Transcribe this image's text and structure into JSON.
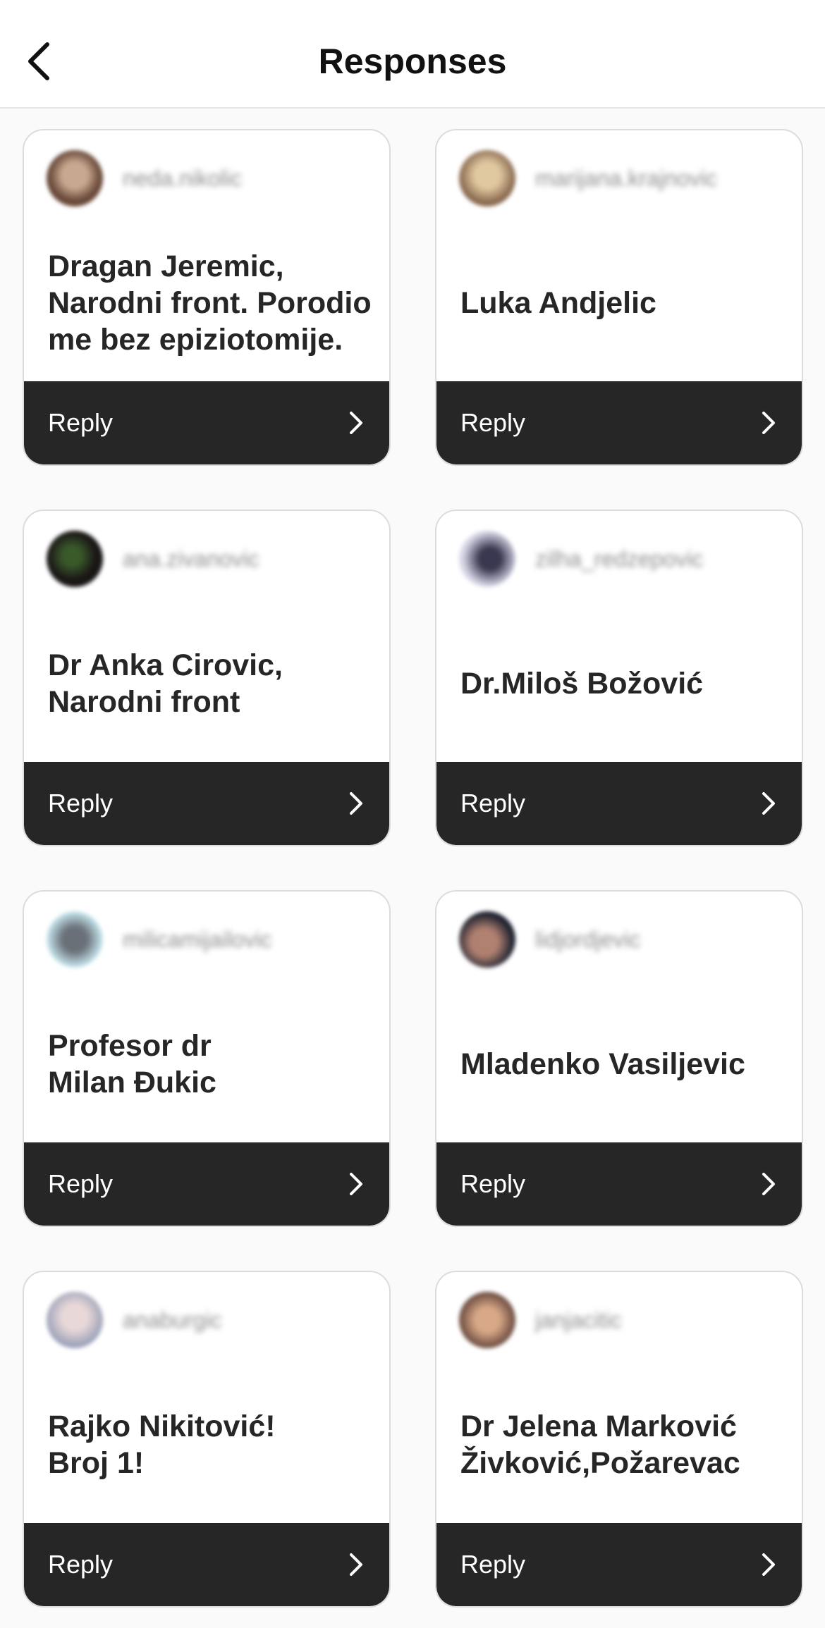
{
  "header": {
    "title": "Responses",
    "back_icon": "chevron-left-icon"
  },
  "cards": [
    {
      "username": "neda.nikolic",
      "answer": "Dragan Jeremic,\nNarodni front. Porodio\nme bez epiziotomije.",
      "reply_label": "Reply",
      "avatar_color": "#8a6a5a"
    },
    {
      "username": "marijana.krajnovic",
      "answer": "Luka Andjelic",
      "reply_label": "Reply",
      "avatar_color": "#b89a7a"
    },
    {
      "username": "ana.zivanovic",
      "answer": "Dr Anka Cirovic,\nNarodni front",
      "reply_label": "Reply",
      "avatar_color": "#2a2a22"
    },
    {
      "username": "zilha_redzepovic",
      "answer": "Dr.Miloš Božović",
      "reply_label": "Reply",
      "avatar_color": "#aab0c8"
    },
    {
      "username": "milicamijailovic",
      "answer": "Profesor dr\nMilan Đukic",
      "reply_label": "Reply",
      "avatar_color": "#7c8c98"
    },
    {
      "username": "lidjordjevic",
      "answer": "Mladenko Vasiljevic",
      "reply_label": "Reply",
      "avatar_color": "#5a4a50"
    },
    {
      "username": "anaburgic",
      "answer": "Rajko Nikitović!\nBroj 1!",
      "reply_label": "Reply",
      "avatar_color": "#b0a8b8"
    },
    {
      "username": "janjacitic",
      "answer": "Dr Jelena Marković\nŽivković,Požarevac",
      "reply_label": "Reply",
      "avatar_color": "#9a7a68"
    }
  ],
  "colors": {
    "reply_bar": "#262626",
    "card_border": "#dcdcdc",
    "background": "#fafafa"
  }
}
